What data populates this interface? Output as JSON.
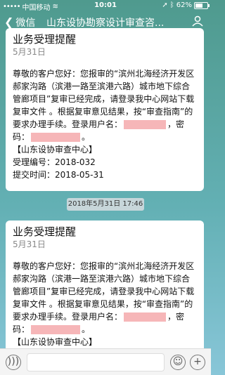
{
  "status": {
    "carrier": "中国移动",
    "time": "10:01",
    "battery": "62%",
    "battery_level": 0.62
  },
  "nav": {
    "back_label": "微信",
    "title": "山东设协勘察设计审查咨..."
  },
  "messages": [
    {
      "title": "业务受理提醒",
      "date": "5月31日",
      "body_intro": "尊敬的客户您好：您报审的“滨州北海经济开发区郝家沟路（滨港一路至滨港六路）城市地下综合管廊项目”复审已经完成，请登录我中心网站下载复审文件 。根据复审意见结果，按“审查指南”的要求办理手续。登录用户名：",
      "pw_label": "，密码：",
      "end_mark": "。",
      "signature": "【山东设协审查中心】",
      "accept_line": "受理编号：2018-032",
      "submit_line": "提交时间：2018-05-31"
    },
    {
      "title": "业务受理提醒",
      "date": "5月31日",
      "body_intro": "尊敬的客户您好：您报审的“滨州北海经济开发区郝家沟路（滨港一路至滨港六路）城市地下综合管廊项目”复审已经完成，请登录我中心网站下载复审文件 。根据复审意见结果，按“审查指南”的要求办理手续。登录用户名：",
      "pw_label": "，密码：",
      "end_mark": "。",
      "signature": "【山东设协审查中心】"
    }
  ],
  "timestamp": "2018年5月31日 17:46",
  "icons": {
    "back": "chevron-left-icon",
    "profile": "person-icon",
    "voice": "voice-icon",
    "emoji": "emoji-icon",
    "plus": "plus-icon"
  }
}
